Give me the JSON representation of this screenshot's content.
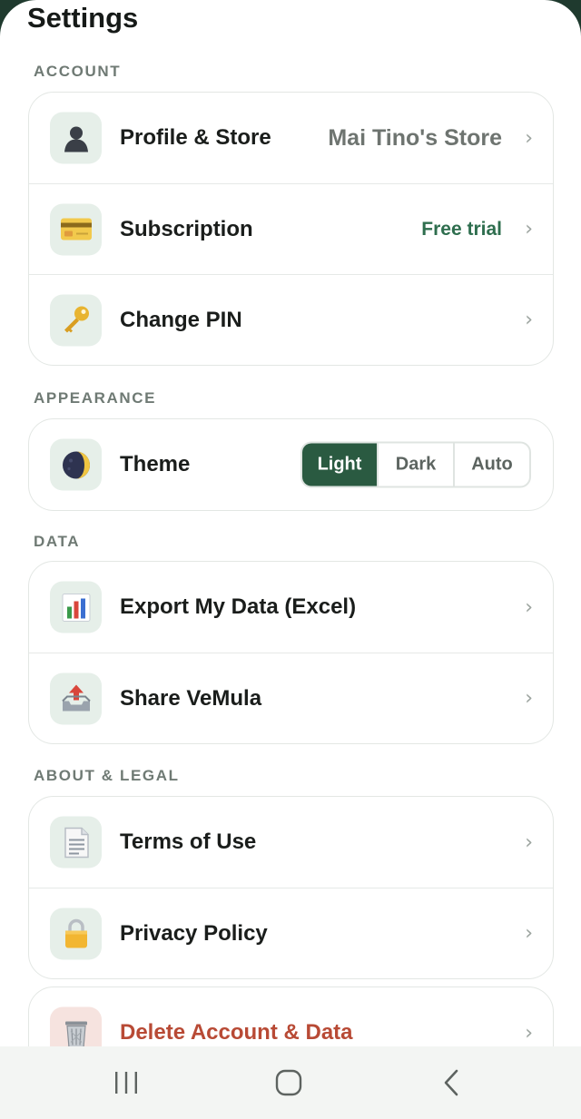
{
  "header": {
    "title": "Settings"
  },
  "sections": {
    "account": {
      "label": "ACCOUNT",
      "items": [
        {
          "label": "Profile & Store",
          "value": "Mai Tino's Store",
          "icon": "person-icon"
        },
        {
          "label": "Subscription",
          "value": "Free trial",
          "icon": "credit-card-icon"
        },
        {
          "label": "Change PIN",
          "icon": "key-icon"
        }
      ]
    },
    "appearance": {
      "label": "APPEARANCE",
      "theme": {
        "label": "Theme",
        "icon": "moon-icon",
        "options": [
          "Light",
          "Dark",
          "Auto"
        ],
        "selected": "Light"
      }
    },
    "data": {
      "label": "DATA",
      "items": [
        {
          "label": "Export My Data (Excel)",
          "icon": "bar-chart-icon"
        },
        {
          "label": "Share VeMula",
          "icon": "outbox-tray-icon"
        }
      ]
    },
    "about": {
      "label": "ABOUT & LEGAL",
      "items": [
        {
          "label": "Terms of Use",
          "icon": "document-icon"
        },
        {
          "label": "Privacy Policy",
          "icon": "lock-icon"
        }
      ]
    },
    "danger": {
      "items": [
        {
          "label": "Delete Account & Data",
          "icon": "trash-icon"
        }
      ]
    }
  },
  "chevron": "›",
  "colors": {
    "accent": "#2a5a41",
    "accent_text": "#2e6e4e",
    "danger": "#b84a35",
    "icon_bg": "#e6efe9"
  },
  "navbar": {
    "icons": [
      "recent-apps-icon",
      "home-icon",
      "back-icon"
    ]
  }
}
